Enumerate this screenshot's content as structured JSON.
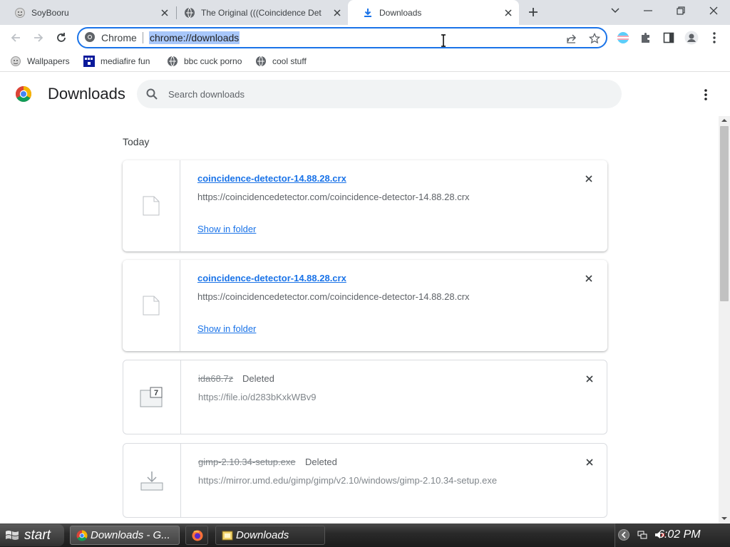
{
  "tabs": [
    {
      "title": "SoyBooru",
      "icon": "soybooru-favicon"
    },
    {
      "title": "The Original (((Coincidence Det",
      "icon": "globe-favicon"
    },
    {
      "title": "Downloads",
      "icon": "download-favicon"
    }
  ],
  "omnibox": {
    "chip_label": "Chrome",
    "url": "chrome://downloads"
  },
  "bookmarks": [
    {
      "label": "Wallpapers",
      "icon": "wallpapers-favicon"
    },
    {
      "label": "mediafire fun",
      "icon": "mediafire-favicon"
    },
    {
      "label": "bbc cuck porno",
      "icon": "globe-favicon"
    },
    {
      "label": "cool stuff",
      "icon": "globe-favicon"
    }
  ],
  "page": {
    "title": "Downloads",
    "search_placeholder": "Search downloads",
    "date_heading": "Today"
  },
  "downloads": [
    {
      "filename": "coincidence-detector-14.88.28.crx",
      "url": "https://coincidencedetector.com/coincidence-detector-14.88.28.crx",
      "action": "Show in folder",
      "status": "",
      "icon": "file-icon"
    },
    {
      "filename": "coincidence-detector-14.88.28.crx",
      "url": "https://coincidencedetector.com/coincidence-detector-14.88.28.crx",
      "action": "Show in folder",
      "status": "",
      "icon": "file-icon"
    },
    {
      "filename": "ida68.7z",
      "url": "https://file.io/d283bKxkWBv9",
      "action": "",
      "status": "Deleted",
      "icon": "7z-archive-icon"
    },
    {
      "filename": "gimp-2.10.34-setup.exe",
      "url": "https://mirror.umd.edu/gimp/gimp/v2.10/windows/gimp-2.10.34-setup.exe",
      "action": "",
      "status": "Deleted",
      "icon": "installer-icon"
    }
  ],
  "taskbar": {
    "start_label": "start",
    "tasks": [
      {
        "label": "Downloads - G...",
        "icon": "chrome-icon"
      },
      {
        "label": "",
        "icon": "firefox-icon"
      },
      {
        "label": "Downloads",
        "icon": "folder-icon"
      }
    ],
    "clock": "6:02 PM"
  },
  "colors": {
    "accent": "#1a73e8",
    "tabstrip": "#dee1e6",
    "url_highlight": "#a8c7fa"
  }
}
